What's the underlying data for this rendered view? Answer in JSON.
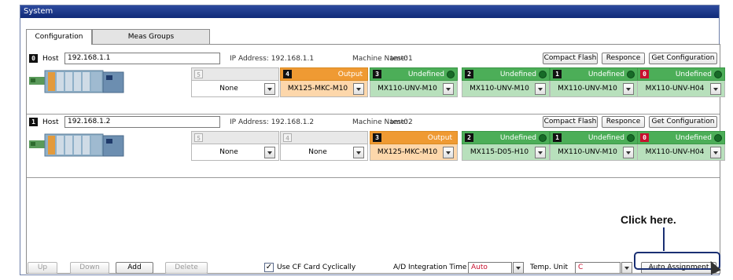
{
  "window": {
    "title": "System"
  },
  "tabs": [
    {
      "label": "Configuration",
      "active": true
    },
    {
      "label": "Meas Groups",
      "active": false
    }
  ],
  "labels": {
    "host": "Host",
    "ip_prefix": "IP Address:",
    "machine_prefix": "Machine Name:"
  },
  "machine_buttons": [
    "Compact Flash",
    "Responce",
    "Get Configuration"
  ],
  "machines": [
    {
      "number": "0",
      "host": "192.168.1.1",
      "ip": "192.168.1.1",
      "machine_name": "test01",
      "slots": [
        {
          "number": "5",
          "status": "",
          "type": "none",
          "module": "None"
        },
        {
          "number": "4",
          "status": "Output",
          "type": "output",
          "module": "MX125-MKC-M10"
        },
        {
          "number": "3",
          "status": "Undefined",
          "type": "undefined",
          "module": "MX110-UNV-M10"
        },
        {
          "number": "2",
          "status": "Undefined",
          "type": "undefined",
          "module": "MX110-UNV-M10"
        },
        {
          "number": "1",
          "status": "Undefined",
          "type": "undefined",
          "module": "MX110-UNV-M10"
        },
        {
          "number": "0",
          "status": "Undefined",
          "type": "undefined",
          "module": "MX110-UNV-H04",
          "red": true
        }
      ]
    },
    {
      "number": "1",
      "host": "192.168.1.2",
      "ip": "192.168.1.2",
      "machine_name": "test02",
      "slots": [
        {
          "number": "5",
          "status": "",
          "type": "none",
          "module": "None"
        },
        {
          "number": "4",
          "status": "",
          "type": "none",
          "module": "None"
        },
        {
          "number": "3",
          "status": "Output",
          "type": "output",
          "module": "MX125-MKC-M10"
        },
        {
          "number": "2",
          "status": "Undefined",
          "type": "undefined",
          "module": "MX115-D05-H10"
        },
        {
          "number": "1",
          "status": "Undefined",
          "type": "undefined",
          "module": "MX110-UNV-M10"
        },
        {
          "number": "0",
          "status": "Undefined",
          "type": "undefined",
          "module": "MX110-UNV-H04",
          "red": true
        }
      ]
    }
  ],
  "footer": {
    "up": "Up",
    "down": "Down",
    "add": "Add",
    "delete": "Delete",
    "use_cf_label": "Use CF Card Cyclically",
    "use_cf_checked": true,
    "ad_label": "A/D Integration Time",
    "ad_value": "Auto",
    "temp_label": "Temp. Unit",
    "temp_value": "C",
    "auto_assignment": "Auto Assignment"
  },
  "callout": {
    "text": "Click here."
  },
  "colors": {
    "titlebar": "#1a3a8c",
    "output": "#ef9a33",
    "undefined": "#4cae58",
    "red_slot": "#c8102e",
    "callout_border": "#1a2f73"
  }
}
